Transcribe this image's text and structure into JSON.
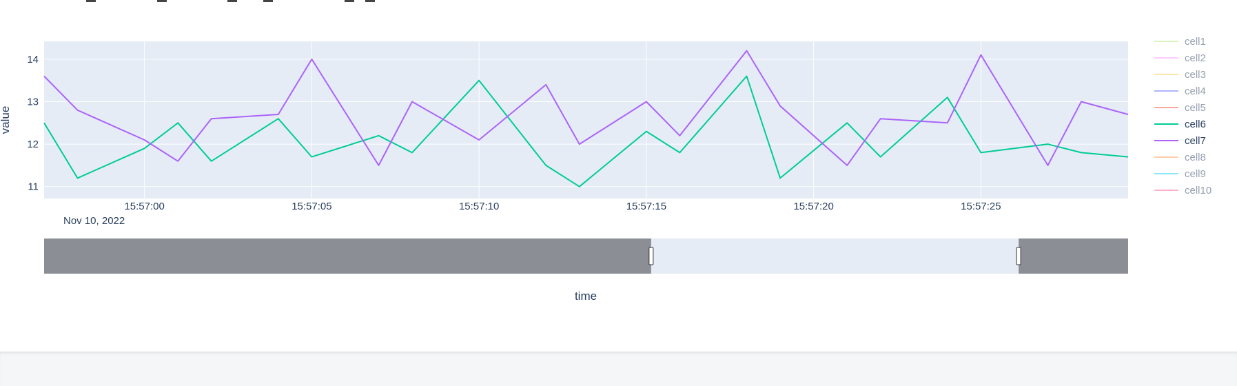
{
  "chart_data": {
    "type": "line",
    "xlabel": "time",
    "ylabel": "value",
    "x_date_label": "Nov 10, 2022",
    "x_start": "15:56:57",
    "x_end": "15:57:29.4",
    "x_tick_labels": [
      "15:57:00",
      "15:57:05",
      "15:57:10",
      "15:57:15",
      "15:57:20",
      "15:57:25"
    ],
    "y_ticks": [
      11,
      12,
      13,
      14
    ],
    "ylim": [
      10.72,
      14.42
    ],
    "grid": true,
    "legend_position": "right",
    "legend": [
      {
        "name": "cell1",
        "color": "#b6e880",
        "visible": false
      },
      {
        "name": "cell2",
        "color": "#ff97ff",
        "visible": false
      },
      {
        "name": "cell3",
        "color": "#fecb52",
        "visible": false
      },
      {
        "name": "cell4",
        "color": "#636efa",
        "visible": false
      },
      {
        "name": "cell5",
        "color": "#ef553b",
        "visible": false
      },
      {
        "name": "cell6",
        "color": "#00cc96",
        "visible": true
      },
      {
        "name": "cell7",
        "color": "#ab63fa",
        "visible": true
      },
      {
        "name": "cell8",
        "color": "#ffa15a",
        "visible": false
      },
      {
        "name": "cell9",
        "color": "#19d3f3",
        "visible": false
      },
      {
        "name": "cell10",
        "color": "#ff6692",
        "visible": false
      }
    ],
    "series": [
      {
        "name": "cell6",
        "color": "#00cc96",
        "x": [
          "15:56:57",
          "15:56:58",
          "15:57:00",
          "15:57:01",
          "15:57:02",
          "15:57:04",
          "15:57:05",
          "15:57:07",
          "15:57:08",
          "15:57:10",
          "15:57:12",
          "15:57:13",
          "15:57:15",
          "15:57:16",
          "15:57:18",
          "15:57:19",
          "15:57:21",
          "15:57:22",
          "15:57:24",
          "15:57:25",
          "15:57:27",
          "15:57:28",
          "15:57:29.4"
        ],
        "values": [
          12.5,
          11.2,
          11.9,
          12.5,
          11.6,
          12.6,
          11.7,
          12.2,
          11.8,
          13.5,
          11.5,
          11.0,
          12.3,
          11.8,
          13.6,
          11.2,
          12.5,
          11.7,
          13.1,
          11.8,
          12.0,
          11.8,
          11.7
        ]
      },
      {
        "name": "cell7",
        "color": "#ab63fa",
        "x": [
          "15:56:57",
          "15:56:58",
          "15:57:00",
          "15:57:01",
          "15:57:02",
          "15:57:04",
          "15:57:05",
          "15:57:07",
          "15:57:08",
          "15:57:10",
          "15:57:12",
          "15:57:13",
          "15:57:15",
          "15:57:16",
          "15:57:18",
          "15:57:19",
          "15:57:21",
          "15:57:22",
          "15:57:24",
          "15:57:25",
          "15:57:27",
          "15:57:28",
          "15:57:29.4"
        ],
        "values": [
          13.6,
          12.8,
          12.1,
          11.6,
          12.6,
          12.7,
          14.0,
          11.5,
          13.0,
          12.1,
          13.4,
          12.0,
          13.0,
          12.2,
          14.2,
          12.9,
          11.5,
          12.6,
          12.5,
          14.1,
          11.5,
          13.0,
          12.7
        ]
      }
    ],
    "rangeslider": {
      "selected_start": "15:56:57",
      "selected_end": "15:57:29.4",
      "window_start_fraction": 0.56,
      "window_end_fraction": 0.899
    }
  },
  "colors": {
    "plot_bg": "#e5ecf6",
    "grid": "#ffffff",
    "tick_text": "#2a3f5f",
    "legend_hidden_text": "#a3acb8",
    "slider_mask": "#8b8e95"
  }
}
